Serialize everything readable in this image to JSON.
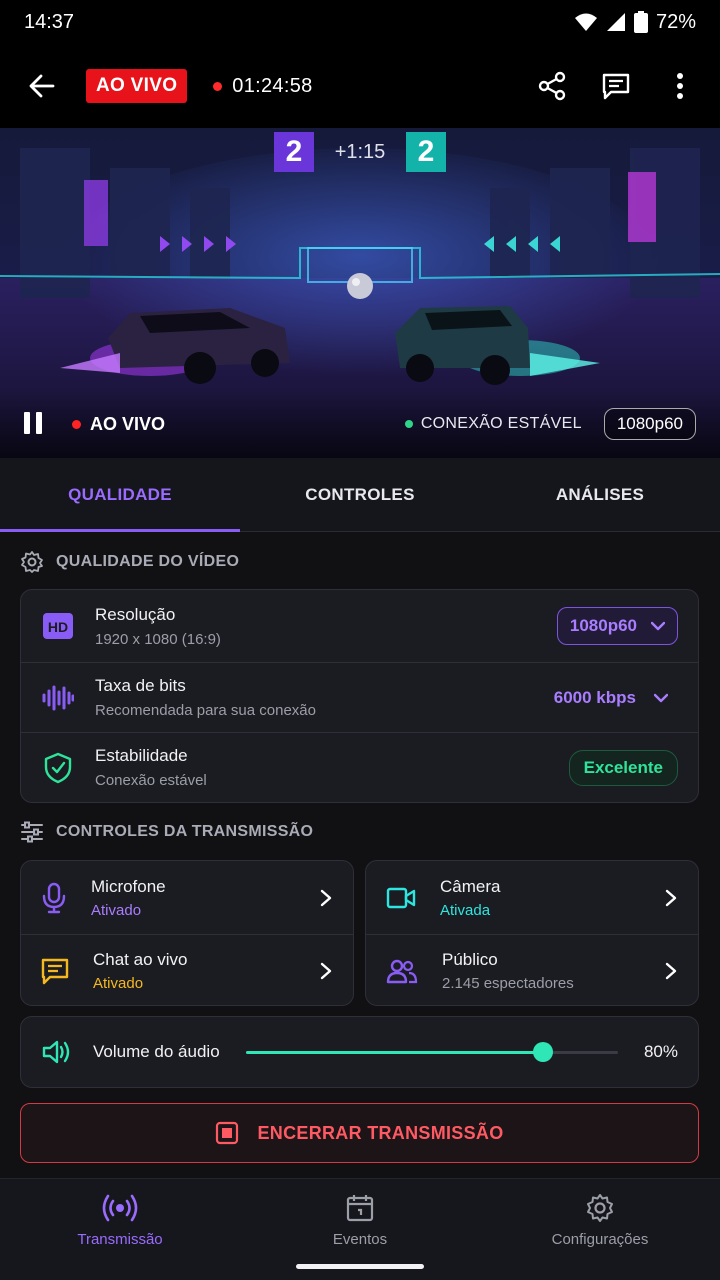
{
  "status_bar": {
    "time": "14:37",
    "battery": "72%"
  },
  "header": {
    "live_label": "AO VIVO",
    "elapsed": "01:24:58"
  },
  "video": {
    "score_left": "2",
    "score_right": "2",
    "game_clock": "+1:15",
    "live_label": "AO VIVO",
    "connection": "CONEXÃO ESTÁVEL",
    "quality": "1080p60"
  },
  "tabs": [
    "QUALIDADE",
    "CONTROLES",
    "ANÁLISES"
  ],
  "quality_section": {
    "title": "QUALIDADE DO VÍDEO",
    "resolution": {
      "title": "Resolução",
      "sub": "1920 x 1080 (16:9)",
      "value": "1080p60",
      "icon_label": "HD"
    },
    "bitrate": {
      "title": "Taxa de bits",
      "sub": "Recomendada para sua conexão",
      "value": "6000 kbps"
    },
    "stability": {
      "title": "Estabilidade",
      "sub": "Conexão estável",
      "value": "Excelente"
    }
  },
  "controls_section": {
    "title": "CONTROLES DA TRANSMISSÃO",
    "microphone": {
      "title": "Microfone",
      "status": "Ativado"
    },
    "camera": {
      "title": "Câmera",
      "status": "Ativada"
    },
    "chat": {
      "title": "Chat ao vivo",
      "status": "Ativado"
    },
    "audience": {
      "title": "Público",
      "status": "2.145 espectadores"
    }
  },
  "volume": {
    "label": "Volume do áudio",
    "value": 80,
    "display": "80%"
  },
  "end_button": "ENCERRAR TRANSMISSÃO",
  "bottom_nav": [
    "Transmissão",
    "Eventos",
    "Configurações"
  ],
  "colors": {
    "accent": "#8a5cf6",
    "live": "#e8121b",
    "teal": "#2ee6b6",
    "amber": "#f5b820",
    "danger": "#ff5a63"
  }
}
